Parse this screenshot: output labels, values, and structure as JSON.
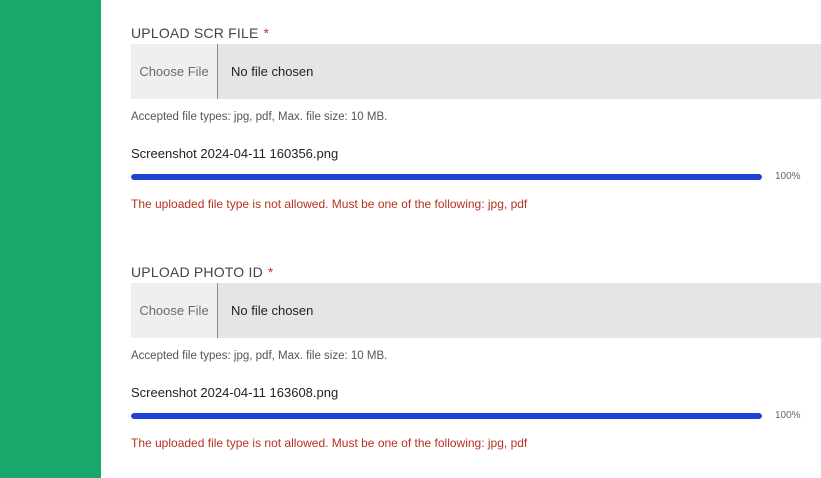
{
  "colors": {
    "sidebar": "#1aa76b",
    "progress": "#1f44d4",
    "required": "#c0392b",
    "error": "#b5321f"
  },
  "uploads": [
    {
      "label": "UPLOAD SCR FILE",
      "required_mark": "*",
      "choose_label": "Choose File",
      "file_status": "No file chosen",
      "hint": "Accepted file types: jpg, pdf, Max. file size: 10 MB.",
      "filename": "Screenshot 2024-04-11 160356.png",
      "progress": 100,
      "progress_label": "100%",
      "error": "The uploaded file type is not allowed. Must be one of the following: jpg, pdf"
    },
    {
      "label": "UPLOAD PHOTO ID",
      "required_mark": "*",
      "choose_label": "Choose File",
      "file_status": "No file chosen",
      "hint": "Accepted file types: jpg, pdf, Max. file size: 10 MB.",
      "filename": "Screenshot 2024-04-11 163608.png",
      "progress": 100,
      "progress_label": "100%",
      "error": "The uploaded file type is not allowed. Must be one of the following: jpg, pdf"
    }
  ]
}
